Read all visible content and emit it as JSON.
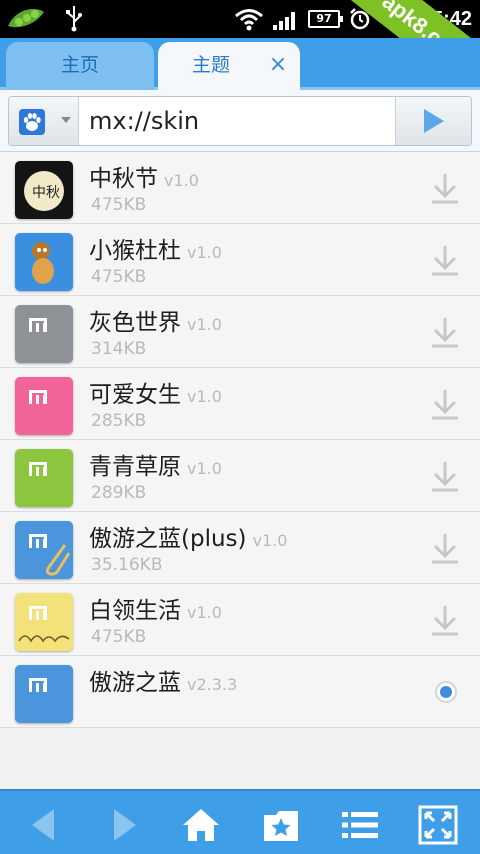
{
  "status_bar": {
    "battery": "97",
    "time": "5:42"
  },
  "watermark": "apk8.com",
  "tabs": [
    {
      "label": "主页"
    },
    {
      "label": "主题",
      "close": "×"
    }
  ],
  "address_bar": {
    "url": "mx://skin"
  },
  "skins": [
    {
      "name": "中秋节",
      "version": "v1.0",
      "size": "475KB",
      "action": "download"
    },
    {
      "name": "小猴杜杜",
      "version": "v1.0",
      "size": "475KB",
      "action": "download"
    },
    {
      "name": "灰色世界",
      "version": "v1.0",
      "size": "314KB",
      "action": "download"
    },
    {
      "name": "可爱女生",
      "version": "v1.0",
      "size": "285KB",
      "action": "download"
    },
    {
      "name": "青青草原",
      "version": "v1.0",
      "size": "289KB",
      "action": "download"
    },
    {
      "name": "傲游之蓝(plus)",
      "version": "v1.0",
      "size": "35.16KB",
      "action": "download"
    },
    {
      "name": "白领生活",
      "version": "v1.0",
      "size": "475KB",
      "action": "download"
    },
    {
      "name": "傲游之蓝",
      "version": "v2.3.3",
      "size": "",
      "action": "selected"
    }
  ],
  "colors": {
    "accent": "#3f9ee8",
    "thumb_gray": "#8e9296",
    "thumb_pink": "#f0649a",
    "thumb_green": "#8cc63e",
    "thumb_blue": "#4a95dc",
    "thumb_yellow": "#f3e27a"
  },
  "toolbar_icons": [
    "back-icon",
    "forward-icon",
    "home-icon",
    "favorites-icon",
    "menu-icon",
    "fullscreen-icon"
  ]
}
